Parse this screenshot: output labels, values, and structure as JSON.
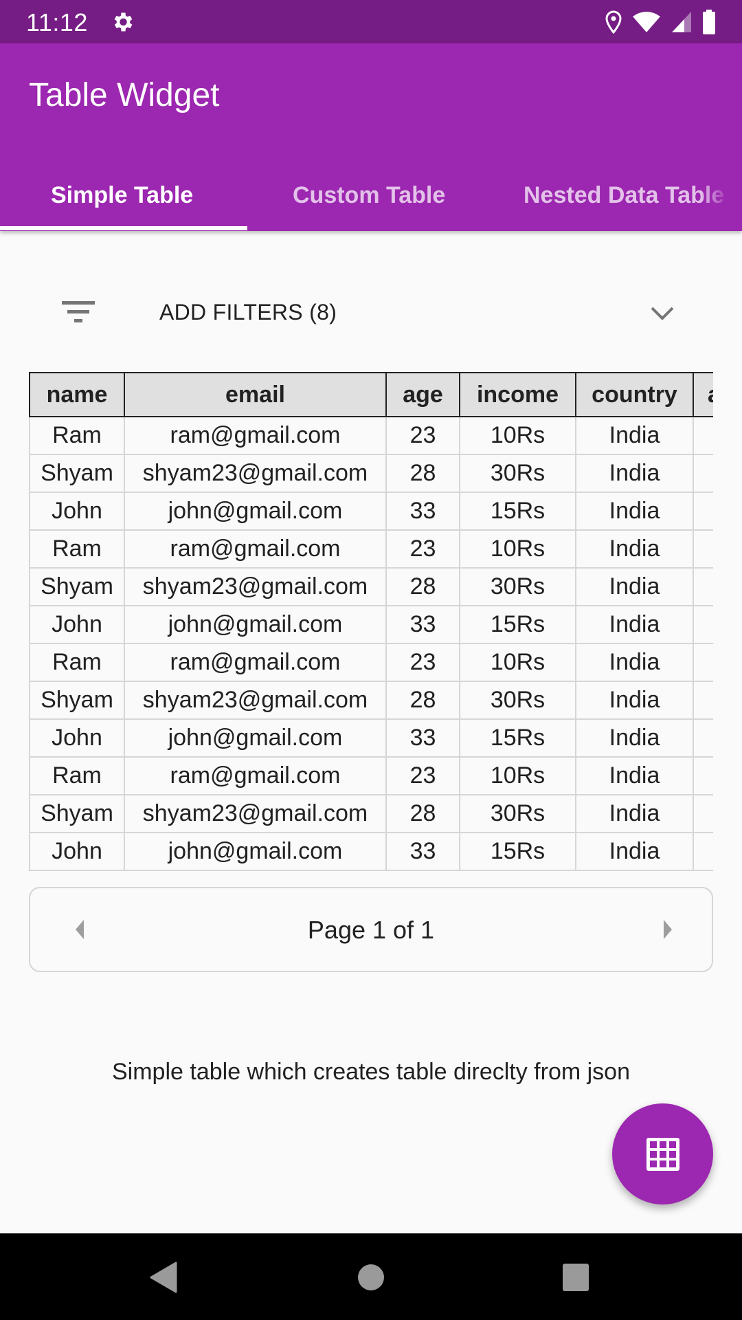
{
  "status_bar": {
    "time": "11:12",
    "icons": [
      "gear-icon",
      "location-icon",
      "wifi-icon",
      "cell-signal-icon",
      "battery-icon"
    ]
  },
  "app_bar": {
    "title": "Table Widget",
    "tabs": [
      {
        "label": "Simple Table",
        "active": true
      },
      {
        "label": "Custom Table",
        "active": false
      },
      {
        "label": "Nested Data Table",
        "active": false
      }
    ]
  },
  "filter": {
    "icon": "filter-list-icon",
    "label": "ADD FILTERS (8)",
    "expand_icon": "chevron-down-icon"
  },
  "table": {
    "columns": [
      "name",
      "email",
      "age",
      "income",
      "country",
      "a"
    ],
    "rows": [
      [
        "Ram",
        "ram@gmail.com",
        "23",
        "10Rs",
        "India",
        ""
      ],
      [
        "Shyam",
        "shyam23@gmail.com",
        "28",
        "30Rs",
        "India",
        ""
      ],
      [
        "John",
        "john@gmail.com",
        "33",
        "15Rs",
        "India",
        ""
      ],
      [
        "Ram",
        "ram@gmail.com",
        "23",
        "10Rs",
        "India",
        ""
      ],
      [
        "Shyam",
        "shyam23@gmail.com",
        "28",
        "30Rs",
        "India",
        ""
      ],
      [
        "John",
        "john@gmail.com",
        "33",
        "15Rs",
        "India",
        ""
      ],
      [
        "Ram",
        "ram@gmail.com",
        "23",
        "10Rs",
        "India",
        ""
      ],
      [
        "Shyam",
        "shyam23@gmail.com",
        "28",
        "30Rs",
        "India",
        ""
      ],
      [
        "John",
        "john@gmail.com",
        "33",
        "15Rs",
        "India",
        ""
      ],
      [
        "Ram",
        "ram@gmail.com",
        "23",
        "10Rs",
        "India",
        ""
      ],
      [
        "Shyam",
        "shyam23@gmail.com",
        "28",
        "30Rs",
        "India",
        ""
      ],
      [
        "John",
        "john@gmail.com",
        "33",
        "15Rs",
        "India",
        ""
      ]
    ]
  },
  "pagination": {
    "text": "Page 1 of 1",
    "prev_icon": "arrow-left-icon",
    "next_icon": "arrow-right-icon"
  },
  "caption": "Simple table which creates table direclty from json",
  "fab": {
    "icon": "grid-icon"
  },
  "nav_bar": {
    "icons": [
      "back-icon",
      "home-icon",
      "recents-icon"
    ]
  },
  "colors": {
    "primary": "#9c27b0",
    "primary_dark": "#751d84",
    "background": "#fafafa",
    "header_fill": "#e0e0e0"
  }
}
